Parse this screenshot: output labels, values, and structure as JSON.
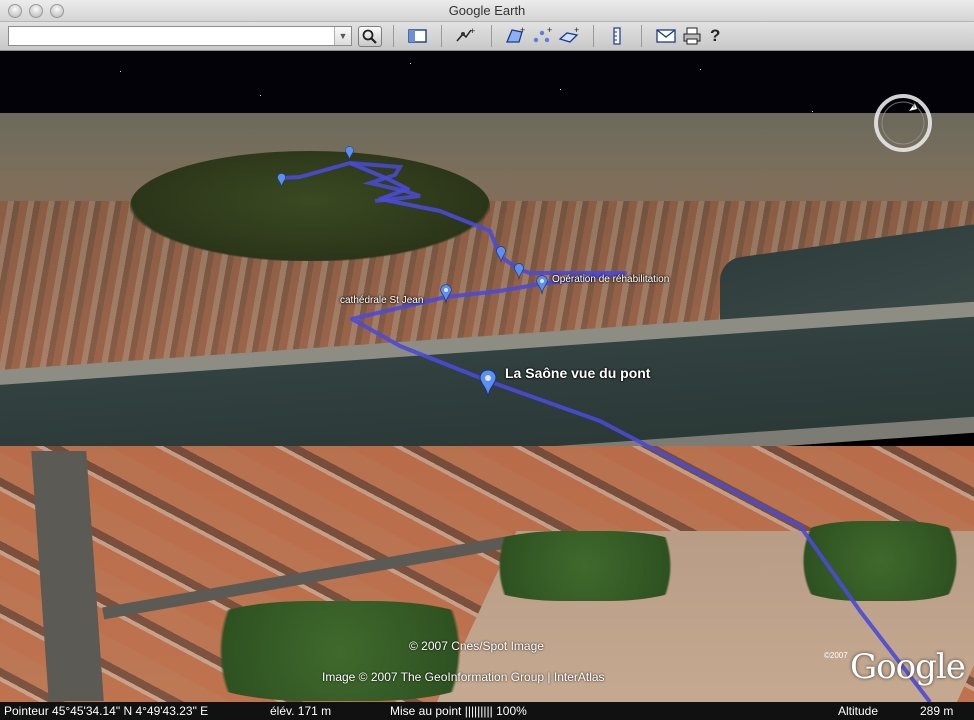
{
  "window": {
    "title": "Google Earth"
  },
  "toolbar": {
    "search_value": "",
    "search_placeholder": "",
    "help_label": "?",
    "icons": [
      "sidebar-icon",
      "placemark-icon",
      "polygon-icon",
      "path-icon",
      "image-overlay-icon",
      "ruler-icon",
      "email-icon",
      "print-icon",
      "help-icon"
    ]
  },
  "map": {
    "placemarks": [
      {
        "label": "La Saône vue du pont"
      },
      {
        "label": "cathédrale St Jean"
      },
      {
        "label": "Opération de réhabilitation"
      }
    ],
    "copyright_spot": "© 2007 Cnes/Spot Image",
    "copyright_image": "Image © 2007 The GeoInformation Group | InterAtlas",
    "logo_text": "Google",
    "logo_year": "©2007",
    "route_color": "#4a4ad8",
    "placemark_color": "#5b8ff0"
  },
  "status": {
    "pointer": "Pointeur 45°45'34.14\" N   4°49'43.23\" E",
    "elevation": "élév.    171 m",
    "streaming": "Mise au point ||||||||| 100%",
    "altitude_label": "Altitude",
    "altitude_value": "289 m"
  }
}
